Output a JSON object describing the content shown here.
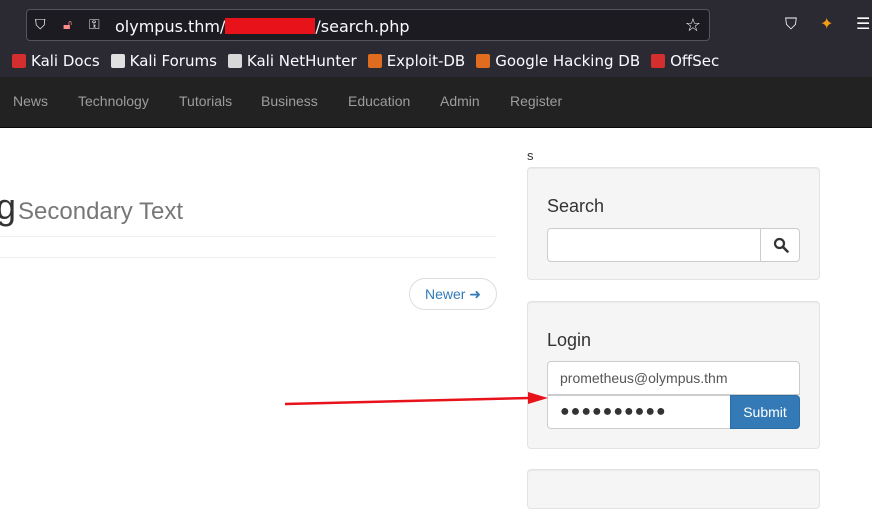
{
  "browser": {
    "url_prefix": "olympus.thm/",
    "url_suffix": "/search.php",
    "bookmarks": [
      {
        "label": "Kali Docs",
        "icon": "kali-docs-icon",
        "color": "#d42e2e"
      },
      {
        "label": "Kali Forums",
        "icon": "kali-dragon-icon",
        "color": "#e0e0e0"
      },
      {
        "label": "Kali NetHunter",
        "icon": "nethunter-icon",
        "color": "#d8d8d8"
      },
      {
        "label": "Exploit-DB",
        "icon": "exploit-db-icon",
        "color": "#e06c1f"
      },
      {
        "label": "Google Hacking DB",
        "icon": "ghdb-icon",
        "color": "#e06c1f"
      },
      {
        "label": "OffSec",
        "icon": "offsec-icon",
        "color": "#d42e2e"
      }
    ]
  },
  "nav": {
    "items": [
      "News",
      "Technology",
      "Tutorials",
      "Business",
      "Education",
      "Admin",
      "Register"
    ]
  },
  "main": {
    "heading_tail": "g",
    "heading_secondary": "Secondary Text",
    "pager_newer": "Newer ➜"
  },
  "sidebar": {
    "stray_text": "s",
    "search": {
      "title": "Search",
      "value": ""
    },
    "login": {
      "title": "Login",
      "email_value": "prometheus@olympus.thm",
      "password_mask": "●●●●●●●●●●",
      "submit_label": "Submit"
    }
  },
  "annotation": {
    "color": "#e8121b"
  }
}
